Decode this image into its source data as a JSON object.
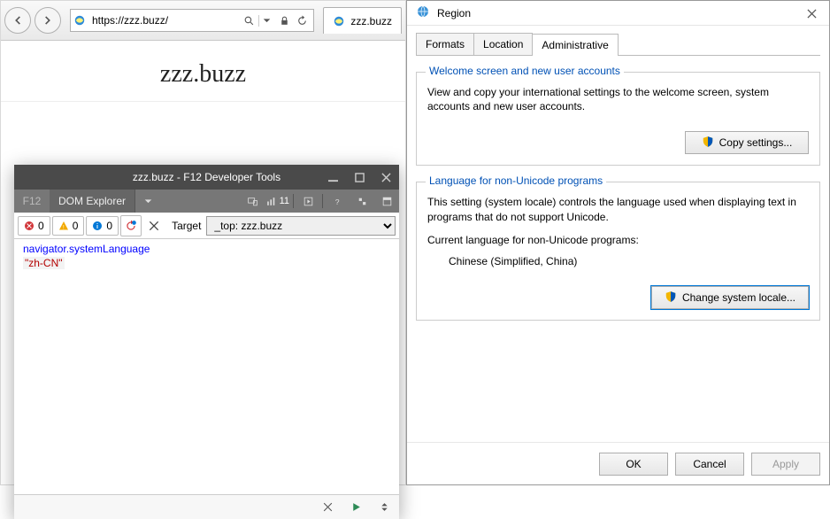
{
  "ie": {
    "url": "https://zzz.buzz/",
    "tab_label": "zzz.buzz",
    "page_title": "zzz.buzz"
  },
  "devtools": {
    "title": "zzz.buzz - F12 Developer Tools",
    "f12": "F12",
    "tab": "DOM Explorer",
    "cpu_count": "11",
    "errors": "0",
    "warnings": "0",
    "infos": "0",
    "target_label": "Target",
    "target_value": "_top: zzz.buzz",
    "console_input": "navigator.systemLanguage",
    "console_output": "\"zh-CN\""
  },
  "region": {
    "title": "Region",
    "tabs": {
      "formats": "Formats",
      "location": "Location",
      "administrative": "Administrative"
    },
    "group1": {
      "legend": "Welcome screen and new user accounts",
      "text": "View and copy your international settings to the welcome screen, system accounts and new user accounts.",
      "button": "Copy settings..."
    },
    "group2": {
      "legend": "Language for non-Unicode programs",
      "text": "This setting (system locale) controls the language used when displaying text in programs that do not support Unicode.",
      "current_label": "Current language for non-Unicode programs:",
      "current_value": "Chinese (Simplified, China)",
      "button": "Change system locale..."
    },
    "buttons": {
      "ok": "OK",
      "cancel": "Cancel",
      "apply": "Apply"
    }
  }
}
